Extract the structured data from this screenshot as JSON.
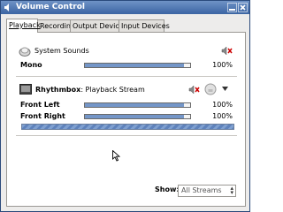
{
  "window": {
    "title": "Volume Control"
  },
  "tabs": [
    {
      "label": "Playback",
      "active": true
    },
    {
      "label": "Recording",
      "active": false
    },
    {
      "label": "Output Devices",
      "active": false
    },
    {
      "label": "Input Devices",
      "active": false
    }
  ],
  "system_sounds": {
    "label": "System Sounds",
    "channels": [
      {
        "label": "Mono",
        "percent_text": "100%",
        "level": 0.94
      }
    ],
    "muted_icon": "speaker-muted-icon"
  },
  "stream": {
    "app_name": "Rhythmbox",
    "stream_name": ": Playback Stream",
    "channels": [
      {
        "label": "Front Left",
        "percent_text": "100%",
        "level": 0.94
      },
      {
        "label": "Front Right",
        "percent_text": "100%",
        "level": 0.94
      }
    ],
    "peak_level": 1.0
  },
  "footer": {
    "show_label": "Show:",
    "show_value": "All Streams"
  },
  "colors": {
    "title_bar": "#3b64a3",
    "slider_fill": "#7496c8",
    "mute_red": "#cc0000"
  }
}
